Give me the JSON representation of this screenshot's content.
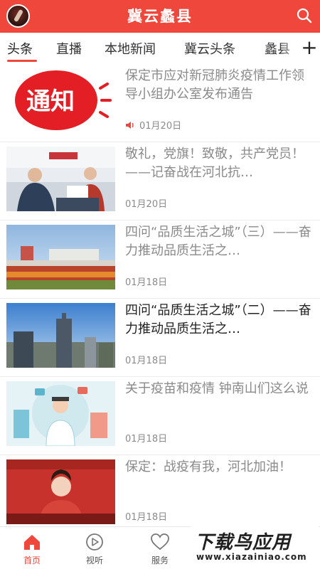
{
  "header": {
    "title": "冀云蠡县"
  },
  "tabs": [
    "头条",
    "直播",
    "本地新闻",
    "冀云头条",
    "蠡县"
  ],
  "tabs_more": "+",
  "news": [
    {
      "title": "保定市应对新冠肺炎疫情工作领导小组办公室发布通告",
      "date": "01月20日",
      "read": true,
      "audio": true,
      "thumb_text": "通知"
    },
    {
      "title": "敬礼，党旗！致敬，共产党员！——记奋战在河北抗…",
      "date": "01月20日",
      "read": true,
      "audio": false
    },
    {
      "title": "四问“品质生活之城”（三）——奋力推动品质生活之…",
      "date": "01月18日",
      "read": true,
      "audio": false
    },
    {
      "title": "四问“品质生活之城”（二）——奋力推动品质生活之…",
      "date": "01月18日",
      "read": false,
      "audio": false
    },
    {
      "title": "关于疫苗和疫情 钟南山们这么说",
      "date": "01月18日",
      "read": true,
      "audio": false
    },
    {
      "title": "保定：战疫有我，河北加油！",
      "date": "01月18日",
      "read": true,
      "audio": false
    }
  ],
  "bottom_nav": [
    {
      "label": "首页",
      "icon": "home-icon",
      "active": true
    },
    {
      "label": "视听",
      "icon": "play-icon",
      "active": false
    },
    {
      "label": "服务",
      "icon": "heart-icon",
      "active": false
    }
  ],
  "watermark": {
    "line1": "下载鸟应用",
    "line2": "www.xiazainiao.com"
  },
  "colors": {
    "accent": "#f0473c",
    "read_text": "#8a8a8a",
    "unread_text": "#222222"
  }
}
